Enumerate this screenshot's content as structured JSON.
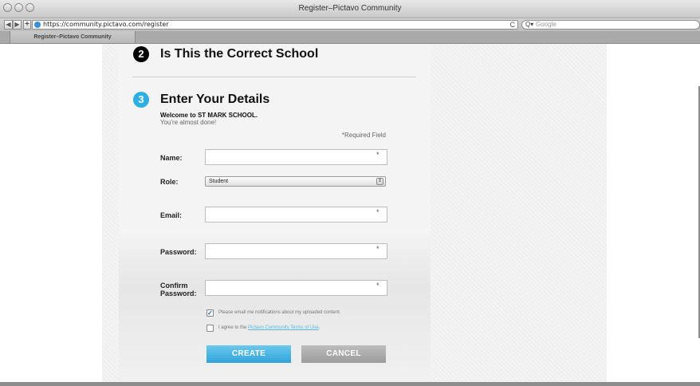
{
  "browser": {
    "window_title": "Register–Pictavo Community",
    "back": "◀",
    "forward": "▶",
    "add": "+",
    "url": "https://community.pictavo.com/register",
    "reload": "C",
    "search_icon": "Q▾",
    "search_placeholder": "Google",
    "tab_title": "Register–Pictavo Community"
  },
  "steps": {
    "step2": {
      "number": "2",
      "title": "Is This the Correct School"
    },
    "step3": {
      "number": "3",
      "title": "Enter Your Details"
    }
  },
  "welcome": {
    "line1": "Welcome to ST MARK SCHOOL.",
    "line2": "You're almost done!",
    "required_note": "*Required Field"
  },
  "form": {
    "name_label": "Name:",
    "role_label": "Role:",
    "role_value": "Student",
    "email_label": "Email:",
    "password_label": "Password:",
    "confirm_label_1": "Confirm",
    "confirm_label_2": "Password:",
    "required_star": "*",
    "name_value": "",
    "email_value": "",
    "password_value": "",
    "confirm_value": ""
  },
  "checkboxes": {
    "notify_label": "Please email me notifications about my uploaded content.",
    "notify_checked": true,
    "agree_prefix": "I agree to the ",
    "agree_link": "Pictavo Community Terms of Use",
    "agree_suffix": ".",
    "agree_checked": false
  },
  "buttons": {
    "create": "CREATE",
    "cancel": "CANCEL"
  },
  "colors": {
    "step2_circle": "#000000",
    "step3_circle": "#2db0e0",
    "create_button": "#2fa3d8",
    "cancel_button": "#a4a4a4",
    "link": "#5ab8e0"
  }
}
